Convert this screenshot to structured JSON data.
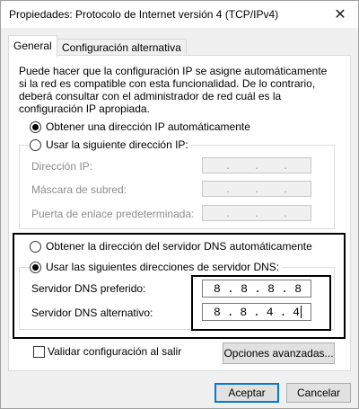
{
  "window": {
    "title": "Propiedades: Protocolo de Internet versión 4 (TCP/IPv4)",
    "close_glyph": "✕"
  },
  "tabs": [
    {
      "label": "General"
    },
    {
      "label": "Configuración alternativa"
    }
  ],
  "description": "Puede hacer que la configuración IP se asigne automáticamente si la red es compatible con esta funcionalidad. De lo contrario, deberá consultar con el administrador de red cuál es la configuración IP apropiada.",
  "ip": {
    "auto_label": "Obtener una dirección IP automáticamente",
    "manual_label": "Usar la siguiente dirección IP:",
    "address_label": "Dirección IP:",
    "mask_label": "Máscara de subred:",
    "gateway_label": "Puerta de enlace predeterminada:",
    "dot": "."
  },
  "dns": {
    "auto_label": "Obtener la dirección del servidor DNS automáticamente",
    "manual_label": "Usar las siguientes direcciones de servidor DNS:",
    "preferred_label": "Servidor DNS preferido:",
    "alternate_label": "Servidor DNS alternativo:",
    "preferred": [
      "8",
      "8",
      "8",
      "8"
    ],
    "alternate": [
      "8",
      "8",
      "4",
      "4"
    ],
    "dot": "."
  },
  "validate_label": "Validar configuración al salir",
  "buttons": {
    "advanced": "Opciones avanzadas...",
    "accept": "Aceptar",
    "cancel": "Cancelar"
  }
}
